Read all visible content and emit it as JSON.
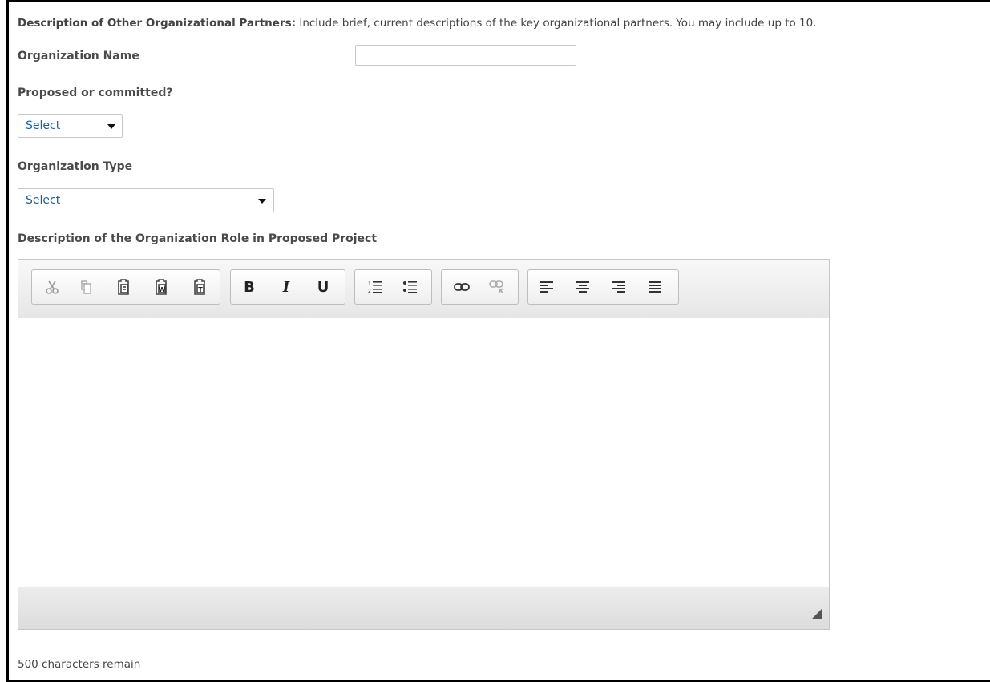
{
  "header": {
    "title": "Description of Other Organizational Partners:",
    "instructions": "Include brief, current descriptions of the key organizational partners. You may include up to 10."
  },
  "fields": {
    "org_name_label": "Organization Name",
    "org_name_value": "",
    "proposed_label": "Proposed or committed?",
    "proposed_value": "Select",
    "org_type_label": "Organization Type",
    "org_type_value": "Select",
    "role_label": "Description of the Organization Role in Proposed Project"
  },
  "editor": {
    "toolbar_groups": [
      [
        "cut-icon",
        "copy-icon",
        "paste-icon",
        "paste-from-word-icon",
        "paste-as-text-icon"
      ],
      [
        "bold-button",
        "italic-button",
        "underline-button"
      ],
      [
        "numbered-list-icon",
        "bulleted-list-icon"
      ],
      [
        "link-icon",
        "unlink-icon"
      ],
      [
        "align-left-icon",
        "align-center-icon",
        "align-right-icon",
        "align-justify-icon"
      ]
    ],
    "bold_label": "B",
    "italic_label": "I",
    "underline_label": "U",
    "content": ""
  },
  "status": {
    "characters_remain": "500 characters remain"
  },
  "colors": {
    "select_text": "#1f5f9a",
    "label_text": "#4a4a4a",
    "border": "#c8c8c8"
  }
}
